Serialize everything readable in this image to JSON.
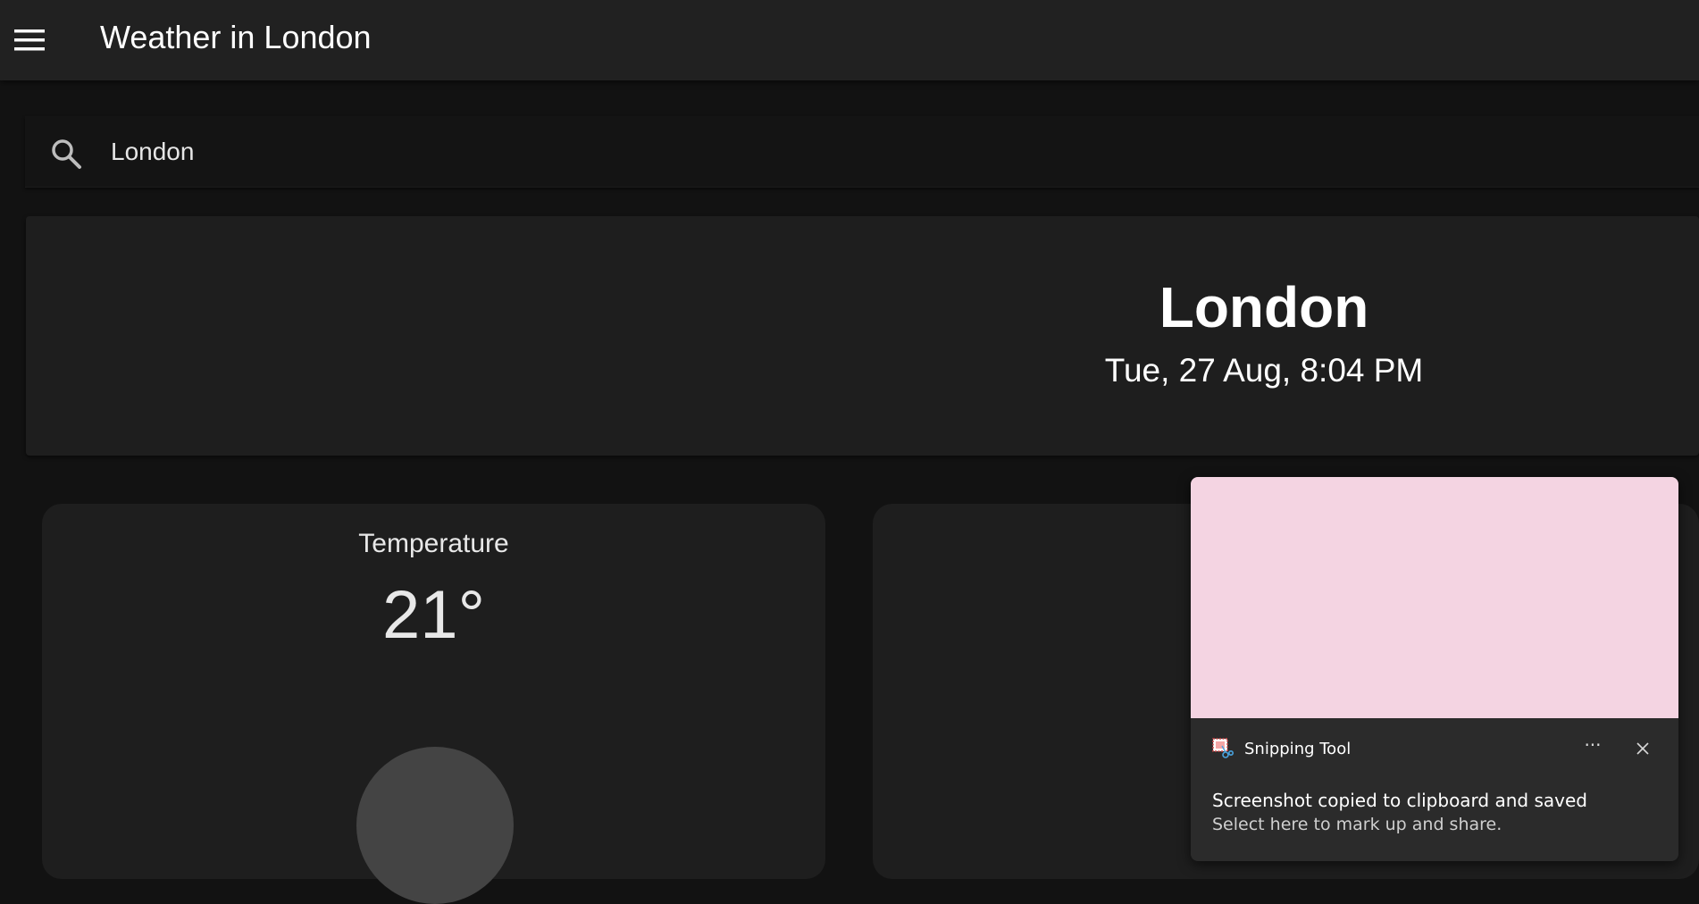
{
  "app": {
    "title": "Weather in London",
    "menu_icon": "hamburger-menu-icon"
  },
  "search": {
    "icon": "search-icon",
    "value": "London"
  },
  "location": {
    "city": "London",
    "datetime": "Tue, 27 Aug, 8:04 PM"
  },
  "temperature_card": {
    "label": "Temperature",
    "value": "21°"
  },
  "toast": {
    "app_name": "Snipping Tool",
    "app_icon": "snipping-tool-icon",
    "more_label": "···",
    "close_icon": "close-icon",
    "message": "Screenshot copied to clipboard and saved",
    "subtext": "Select here to mark up and share."
  },
  "colors": {
    "background": "#121212",
    "appbar": "#212121",
    "card": "#1e1e1e",
    "toast_preview": "#f4d4e2"
  }
}
